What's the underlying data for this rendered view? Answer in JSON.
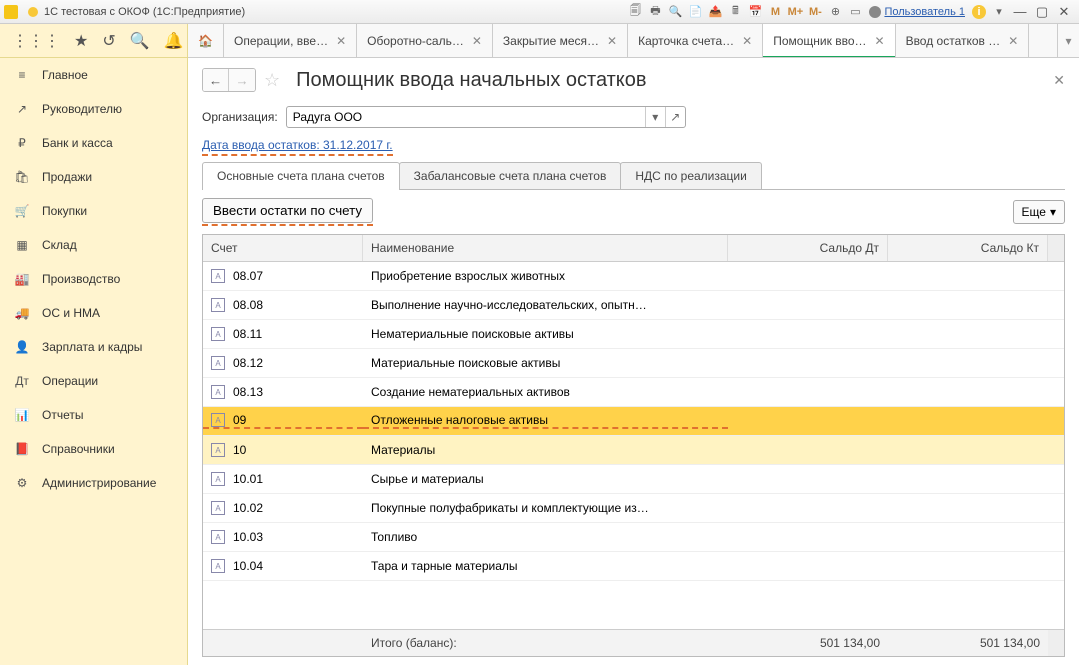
{
  "window": {
    "title": "1С тестовая с ОКОФ  (1С:Предприятие)",
    "user": "Пользователь 1",
    "m_labels": [
      "M",
      "M+",
      "M-"
    ]
  },
  "sidebar": {
    "items": [
      {
        "icon": "≡",
        "label": "Главное"
      },
      {
        "icon": "↗",
        "label": "Руководителю"
      },
      {
        "icon": "₽",
        "label": "Банк и касса"
      },
      {
        "icon": "🛍",
        "label": "Продажи"
      },
      {
        "icon": "🛒",
        "label": "Покупки"
      },
      {
        "icon": "▦",
        "label": "Склад"
      },
      {
        "icon": "🏭",
        "label": "Производство"
      },
      {
        "icon": "🚚",
        "label": "ОС и НМА"
      },
      {
        "icon": "👤",
        "label": "Зарплата и кадры"
      },
      {
        "icon": "Дт",
        "label": "Операции"
      },
      {
        "icon": "📊",
        "label": "Отчеты"
      },
      {
        "icon": "📕",
        "label": "Справочники"
      },
      {
        "icon": "⚙",
        "label": "Администрирование"
      }
    ]
  },
  "tabs": [
    {
      "label": "Операции, вве…",
      "active": false
    },
    {
      "label": "Оборотно-саль…",
      "active": false
    },
    {
      "label": "Закрытие меся…",
      "active": false
    },
    {
      "label": "Карточка счета…",
      "active": false
    },
    {
      "label": "Помощник вво…",
      "active": true
    },
    {
      "label": "Ввод остатков …",
      "active": false
    }
  ],
  "page": {
    "title": "Помощник ввода начальных остатков",
    "org_label": "Организация:",
    "org_value": "Радуга ООО",
    "date_link": "Дата ввода остатков: 31.12.2017 г.",
    "subtabs": [
      "Основные счета плана счетов",
      "Забалансовые счета плана счетов",
      "НДС по реализации"
    ],
    "active_subtab": 0,
    "enter_btn": "Ввести остатки по счету",
    "more_btn": "Еще"
  },
  "table": {
    "headers": {
      "account": "Счет",
      "name": "Наименование",
      "dt": "Сальдо Дт",
      "kt": "Сальдо Кт"
    },
    "rows": [
      {
        "code": "08.07",
        "name": "Приобретение взрослых животных",
        "dt": "",
        "kt": ""
      },
      {
        "code": "08.08",
        "name": "Выполнение научно-исследовательских, опытн…",
        "dt": "",
        "kt": ""
      },
      {
        "code": "08.11",
        "name": "Нематериальные поисковые активы",
        "dt": "",
        "kt": ""
      },
      {
        "code": "08.12",
        "name": "Материальные поисковые активы",
        "dt": "",
        "kt": ""
      },
      {
        "code": "08.13",
        "name": "Создание нематериальных активов",
        "dt": "",
        "kt": ""
      },
      {
        "code": "09",
        "name": "Отложенные налоговые активы",
        "dt": "",
        "kt": "",
        "highlight": true
      },
      {
        "code": "10",
        "name": "Материалы",
        "dt": "",
        "kt": "",
        "sub": true
      },
      {
        "code": "10.01",
        "name": "Сырье и материалы",
        "dt": "",
        "kt": ""
      },
      {
        "code": "10.02",
        "name": "Покупные полуфабрикаты и комплектующие из…",
        "dt": "",
        "kt": ""
      },
      {
        "code": "10.03",
        "name": "Топливо",
        "dt": "",
        "kt": ""
      },
      {
        "code": "10.04",
        "name": "Тара и тарные материалы",
        "dt": "",
        "kt": ""
      }
    ],
    "footer": {
      "label": "Итого (баланс):",
      "dt": "501 134,00",
      "kt": "501 134,00"
    }
  }
}
